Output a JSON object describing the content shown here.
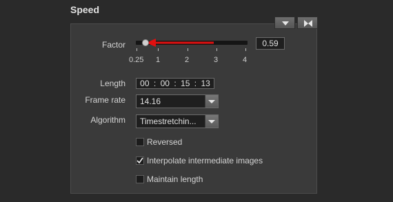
{
  "section": {
    "title": "Speed"
  },
  "header_buttons": {
    "collapse_icon": "triangle-down-icon",
    "fit_icon": "bowtie-icon"
  },
  "factor": {
    "label": "Factor",
    "value": "0.59",
    "ticks": [
      "0.25",
      "1",
      "2",
      "3",
      "4"
    ],
    "slider_range": [
      0.25,
      4
    ],
    "slider_value": 0.59
  },
  "length": {
    "label": "Length",
    "hh": "00",
    "mm": "00",
    "ss": "15",
    "ff": "13"
  },
  "frame_rate": {
    "label": "Frame rate",
    "value": "14.16"
  },
  "algorithm": {
    "label": "Algorithm",
    "value": "Timestretchin..."
  },
  "options": [
    {
      "label": "Reversed",
      "checked": false
    },
    {
      "label": "Interpolate intermediate images",
      "checked": true
    },
    {
      "label": "Maintain length",
      "checked": false
    }
  ],
  "colors": {
    "accent_arrow": "#e01010",
    "panel_bg": "#3a3a3a",
    "page_bg": "#2a2a2a"
  }
}
